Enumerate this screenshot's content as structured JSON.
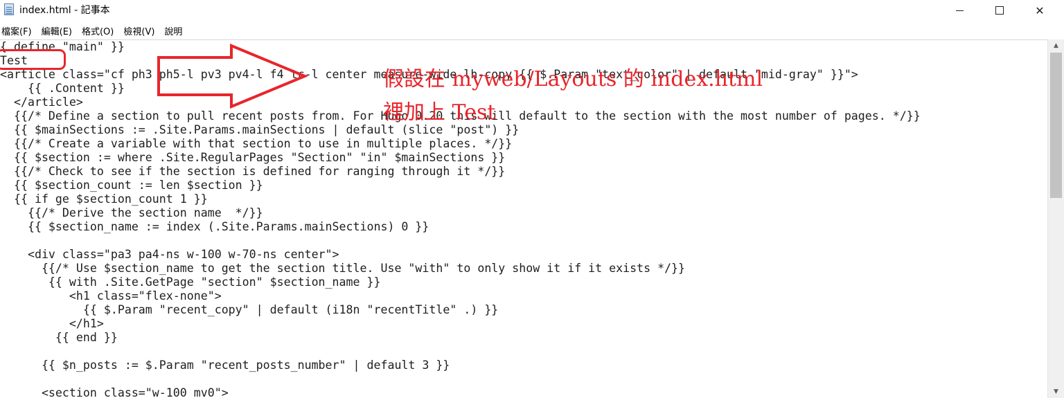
{
  "window": {
    "title": "index.html - 記事本",
    "icon": "notepad-icon"
  },
  "menu": [
    {
      "label": "檔案(F)"
    },
    {
      "label": "編輯(E)"
    },
    {
      "label": "格式(O)"
    },
    {
      "label": "檢視(V)"
    },
    {
      "label": "說明"
    }
  ],
  "editor": {
    "lines": [
      "{ define \"main\" }}",
      "Test",
      "<article class=\"cf ph3 ph5-l pv3 pv4-l f4 tc-l center measure-wide lh-copy {{ $.Param \"text_color\" | default \"mid-gray\" }}\">",
      "    {{ .Content }}",
      "  </article>",
      "  {{/* Define a section to pull recent posts from. For Hugo 0.20 this will default to the section with the most number of pages. */}}",
      "  {{ $mainSections := .Site.Params.mainSections | default (slice \"post\") }}",
      "  {{/* Create a variable with that section to use in multiple places. */}}",
      "  {{ $section := where .Site.RegularPages \"Section\" \"in\" $mainSections }}",
      "  {{/* Check to see if the section is defined for ranging through it */}}",
      "  {{ $section_count := len $section }}",
      "  {{ if ge $section_count 1 }}",
      "    {{/* Derive the section name  */}}",
      "    {{ $section_name := index (.Site.Params.mainSections) 0 }}",
      "",
      "    <div class=\"pa3 pa4-ns w-100 w-70-ns center\">",
      "      {{/* Use $section_name to get the section title. Use \"with\" to only show it if it exists */}}",
      "       {{ with .Site.GetPage \"section\" $section_name }}",
      "          <h1 class=\"flex-none\">",
      "            {{ $.Param \"recent_copy\" | default (i18n \"recentTitle\" .) }}",
      "          </h1>",
      "        {{ end }}",
      "",
      "      {{ $n_posts := $.Param \"recent_posts_number\" | default 3 }}",
      "",
      "      <section class=\"w-100 mv0\">"
    ]
  },
  "annotation": {
    "line1": "假設在 myweb/Layouts 的 index.html",
    "line2": "裡加上 Test",
    "color": "#e8252b"
  },
  "scrollbar": {
    "up_icon": "chevron-up-icon",
    "down_icon": "chevron-down-icon"
  }
}
